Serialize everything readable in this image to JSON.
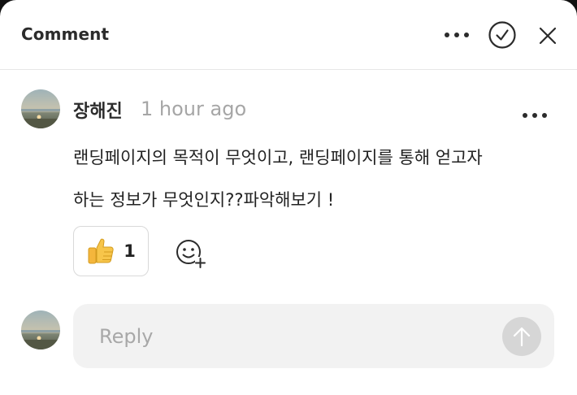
{
  "header": {
    "title": "Comment",
    "icons": {
      "more": "more-horizontal-icon",
      "resolve": "check-circle-icon",
      "close": "close-icon"
    }
  },
  "comment": {
    "author": "장해진",
    "timestamp": "1 hour ago",
    "body_lines": [
      "랜딩페이지의 목적이 무엇이고, 랜딩페이지를 통해 얻고자",
      "하는 정보가 무엇인지??파악해보기 !"
    ],
    "reactions": [
      {
        "emoji": "👍",
        "icon": "thumbs-up-icon",
        "count": "1"
      }
    ],
    "add_reaction_icon": "add-emoji-icon"
  },
  "reply": {
    "placeholder": "Reply",
    "send_icon": "arrow-up-icon"
  },
  "colors": {
    "background": "#ffffff",
    "muted_text": "#a6a6a6",
    "reply_bg": "#f2f2f2",
    "send_disabled": "#d6d6d6"
  }
}
